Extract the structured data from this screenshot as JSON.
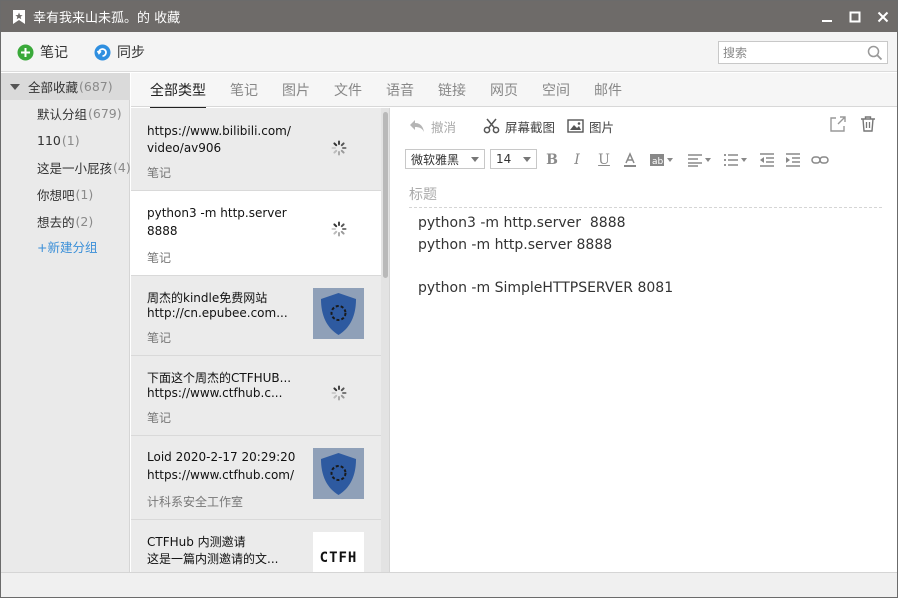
{
  "window": {
    "title": "幸有我来山未孤。的 收藏",
    "title_bar_color": "#6e6b69"
  },
  "toolbar": {
    "note_label": "笔记",
    "sync_label": "同步",
    "search_placeholder": "搜索",
    "note_icon": "plus-circle-icon",
    "sync_icon": "sync-icon"
  },
  "sidebar": {
    "root": {
      "label": "全部收藏",
      "count": "(687)"
    },
    "items": [
      {
        "label": "默认分组",
        "count": "(679)"
      },
      {
        "label": "110",
        "count": "(1)"
      },
      {
        "label": "这是一小屁孩",
        "count": "(4)"
      },
      {
        "label": "你想吧",
        "count": "(1)"
      },
      {
        "label": "想去的",
        "count": "(2)"
      }
    ],
    "new_group": "+新建分组",
    "accent": "#3a8fd8"
  },
  "tabs": [
    "全部类型",
    "笔记",
    "图片",
    "文件",
    "语音",
    "链接",
    "网页",
    "空间",
    "邮件"
  ],
  "active_tab": "全部类型",
  "notes": [
    {
      "line1": "https://www.bilibili.com/",
      "line2": "video/av906",
      "tag": "笔记",
      "thumb": "spinner"
    },
    {
      "line1": "python3 -m http.server",
      "line2": " 8888",
      "tag": "笔记",
      "thumb": "spinner",
      "selected": true
    },
    {
      "line1": "周杰的kindle免费网站",
      "line2": "http://cn.epubee.com...",
      "tag": "笔记",
      "thumb": "shield"
    },
    {
      "line1": "下面这个周杰的CTFHUB...",
      "line2": "https://www.ctfhub.c...",
      "tag": "笔记",
      "thumb": "spinner"
    },
    {
      "line1": "Loid 2020-2-17 20:29:20",
      "line2": "https://www.ctfhub.com/",
      "tag": "计科系安全工作室",
      "thumb": "shield"
    },
    {
      "line1": "CTFHub 内测邀请",
      "line2": "这是一篇内测邀请的文...",
      "tag": "",
      "thumb": "ctfh"
    }
  ],
  "ctfh_logo": "CTFH",
  "editor": {
    "undo_label": "撤消",
    "screenshot_label": "屏幕截图",
    "image_label": "图片",
    "font_family": "微软雅黑",
    "font_size": "14",
    "title_placeholder": "标题",
    "body_lines": [
      "python3 -m http.server  8888",
      "python -m http.server 8888",
      "",
      "python -m SimpleHTTPSERVER 8081"
    ],
    "format_buttons": [
      "bold-icon",
      "italic-icon",
      "underline-icon",
      "font-color-icon",
      "highlight-icon",
      "align-icon",
      "list-icon",
      "outdent-icon",
      "indent-icon",
      "link-icon"
    ]
  }
}
